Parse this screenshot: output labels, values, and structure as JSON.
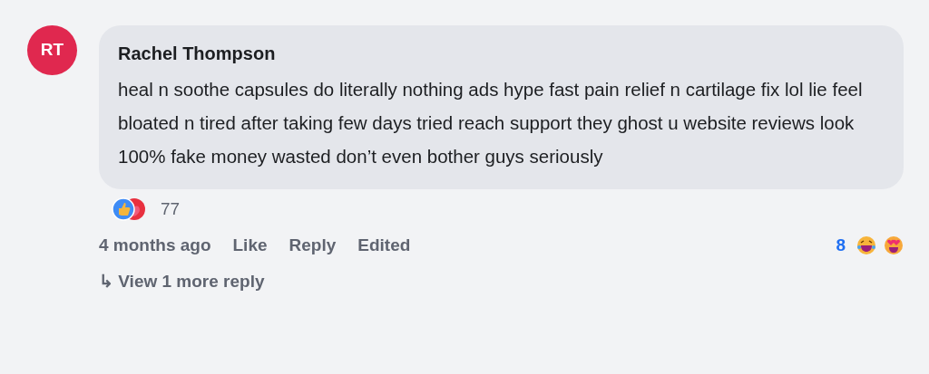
{
  "comment": {
    "avatar_initials": "RT",
    "author": "Rachel Thompson",
    "text": "heal n soothe capsules do literally nothing ads hype fast pain relief n cartilage fix lol lie feel bloated n tired after taking few days tried reach support they ghost u website reviews look 100% fake money wasted don’t even bother guys seriously",
    "reaction_count": "77",
    "time": "4 months ago",
    "actions": [
      "Like",
      "Reply",
      "Edited"
    ],
    "side_count": "8"
  },
  "replies": {
    "arrow": "↳",
    "label": "View 1 more reply"
  }
}
